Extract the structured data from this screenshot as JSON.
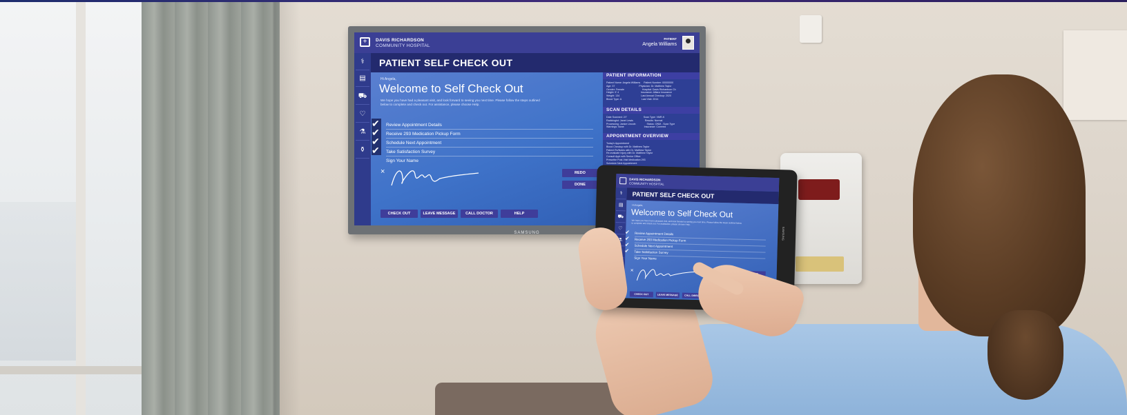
{
  "tv": {
    "brand": "SAMSUNG",
    "app": {
      "hospital_line1": "DAVIS RICHARDSON",
      "hospital_line2": "COMMUNITY HOSPITAL",
      "patient_label": "PATIENT",
      "patient_name": "Angela Williams",
      "title": "PATIENT SELF CHECK OUT",
      "greeting": "Hi Angela,",
      "welcome": "Welcome to Self Check Out",
      "intro": "We hope you have had a pleasant visit, and look forward to seeing you next time. Please follow the steps outlined below to complete and check out. For assistance, please choose Help.",
      "steps": [
        {
          "label": "Review Appointment Details",
          "checked": true
        },
        {
          "label": "Receive 293 Medication Pickup Form",
          "checked": true
        },
        {
          "label": "Schedule Next Appointment",
          "checked": true
        },
        {
          "label": "Take Satisfaction Survey",
          "checked": true
        },
        {
          "label": "Sign Your Name",
          "checked": false
        }
      ],
      "sig_clear": "×",
      "redo": "REDO",
      "done": "DONE",
      "footer_buttons": [
        "CHECK OUT",
        "LEAVE MESSAGE",
        "CALL DOCTOR",
        "HELP"
      ],
      "panel": {
        "info_title": "PATIENT INFORMATION",
        "info_text": "Patient Name: Angela Williams     Patient Number: 00000000\nAge: 37                                   Physician: Dr. Matthew Taylor\nGender: Female                          Hospital: Davis Richardson Ch\nHeight: 5' 4                                Insurance: Allianz Insurance\nWeight: 134                               Last Annual Checkup: 2020\nBlood Type: A                             Last Visit: 2014",
        "scan_title": "SCAN DETAILS",
        "scan_text": "Date Scanned: 2/7                        Scan Type: VMR-K\nRadiologist: Janet Lewis                 Results: Normal\nProcessing: Janice Lincoln                Status: ONM - Scan Type\nWarnings: None                             Insurance: Covered",
        "appt_title": "APPOINTMENT OVERVIEW",
        "appt_text": "Today's Appointment\nBlood Checkup with Dr. Matthew Taylor\nPatient Rx/Notes with Dr. Matthew Taylor\nRe-evaluate Injury with Dr. Matthew Taylor\nConsult Appt with Senior Office\nPrescribe Post-Visit Medication 293\nSchedule Next Appointment"
      }
    }
  },
  "tablet": {
    "brand": "SAMSUNG",
    "app": {
      "hospital_line1": "DAVIS RICHARDSON",
      "hospital_line2": "COMMUNITY HOSPITAL",
      "title": "PATIENT SELF CHECK OUT",
      "greeting": "Hi Angela,",
      "welcome": "Welcome to Self Check Out",
      "intro": "We hope you have had a pleasant visit, and look forward to seeing you next time. Please follow the steps outlined below to complete and check out. For assistance, please choose Help.",
      "steps": [
        "Review Appointment Details",
        "Receive 293 Medication Pickup Form",
        "Schedule Next Appointment",
        "Take Satisfaction Survey",
        "Sign Your Name"
      ],
      "redo": "REDO",
      "done": "DONE",
      "footer_buttons": [
        "CHECK OUT",
        "LEAVE MESSAGE",
        "CALL DIRECTLY"
      ]
    }
  },
  "colors": {
    "header": "#3b3f95",
    "title_bar": "#232a6e",
    "main_blue": "#3f73c9",
    "panel": "#2e3f95",
    "wall": "#ddd5cb"
  }
}
